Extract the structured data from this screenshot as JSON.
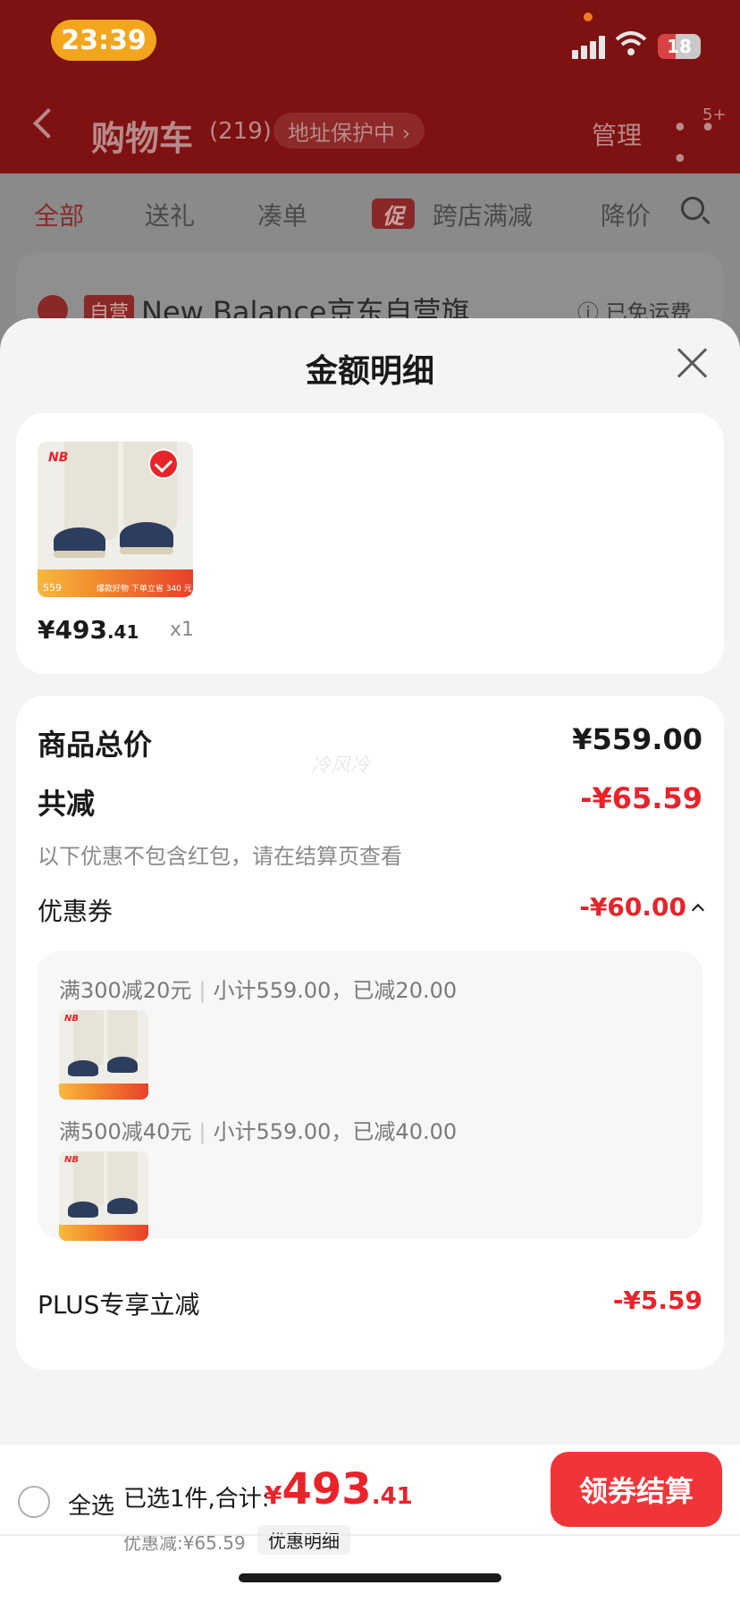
{
  "status_bar": {
    "time": "23:39",
    "battery": "18"
  },
  "nav": {
    "title": "购物车",
    "count": "(219)",
    "address_tag": "地址保护中 ›",
    "manage": "管理",
    "more": "• • •",
    "badge": "5+"
  },
  "filters": {
    "all": "全部",
    "gift": "送礼",
    "combine": "凑单",
    "promo_tag": "促",
    "cross_store": "跨店满减",
    "price_drop": "降价"
  },
  "shop": {
    "tag": "自营",
    "name": "New Balance京东自营旗…",
    "arrow": "›",
    "shipping": "ⓘ 已免运费"
  },
  "sheet": {
    "title": "金额明细",
    "product": {
      "price_int": "¥493",
      "price_dec": ".41",
      "qty": "x1",
      "badge_price": "559",
      "promo_text": "爆款好物 下单立省 340 元"
    },
    "watermark": "冷风冷",
    "total_label": "商品总价",
    "total_value": "¥559.00",
    "discount_label": "共减",
    "discount_value": "-¥65.59",
    "note": "以下优惠不包含红包，请在结算页查看",
    "coupon_label": "优惠券",
    "coupon_value": "-¥60.00",
    "coupons": [
      {
        "rule": "满300减20元",
        "detail": "小计559.00，已减20.00"
      },
      {
        "rule": "满500减40元",
        "detail": "小计559.00，已减40.00"
      }
    ],
    "plus_label": "PLUS专享立减",
    "plus_value": "-¥5.59"
  },
  "footer": {
    "select_all": "全选",
    "selected_text": "已选1件,合计:",
    "amount_yen": "¥",
    "amount_int": "493",
    "amount_dec": ".41",
    "saved_text": "优惠减:¥65.59",
    "detail_chip": "优惠明细",
    "checkout": "领券结算"
  },
  "colors": {
    "accent_red": "#e8232a",
    "header_dark_red": "#7e1111",
    "checkout_red": "#f0353a"
  },
  "icons": [
    "chevron-left-icon",
    "close-icon",
    "search-icon",
    "check-icon",
    "chevron-up-icon",
    "info-icon",
    "wifi-icon",
    "signal-icon"
  ]
}
